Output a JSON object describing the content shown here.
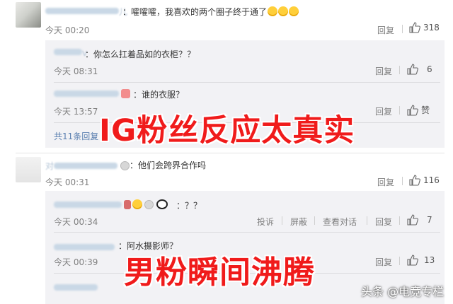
{
  "comment1": {
    "username_suffix": "儿",
    "text": "：嚯嚯嚯，我喜欢的两个圈子终于通了",
    "time": "今天 00:20",
    "reply_label": "回复",
    "like_count": "318"
  },
  "reply1": {
    "username_suffix": "v",
    "text": "：你怎么扛着品如的衣柜？？",
    "time": "今天 08:31",
    "reply_label": "回复",
    "like_count": "6"
  },
  "reply2": {
    "text": "：谁的衣服？",
    "time": "今天 13:57",
    "reply_label": "回复",
    "like_label": "赞"
  },
  "more_replies": "共11条回复",
  "comment2": {
    "username_prefix": "对",
    "text": "：他们会跨界合作吗",
    "time": "今天 00:31",
    "reply_label": "回复",
    "like_count": "116"
  },
  "reply3": {
    "text": "：？？",
    "time": "今天 00:34",
    "report_label": "投诉",
    "block_label": "屏蔽",
    "view_conversation_label": "查看对话",
    "reply_label": "回复",
    "like_count": "7"
  },
  "reply4": {
    "text": "：阿水摄影师？",
    "time": "今天 00:39",
    "reply_label": "回复",
    "like_count": "13"
  },
  "overlay_top": "IG粉丝反应太真实",
  "overlay_bottom": "男粉瞬间沸腾",
  "watermark": "头条 @电竞专栏",
  "colors": {
    "overlay_red": "#f01b1b",
    "link_blue": "#5a7fb0",
    "panel_grey": "#f2f2f5"
  }
}
